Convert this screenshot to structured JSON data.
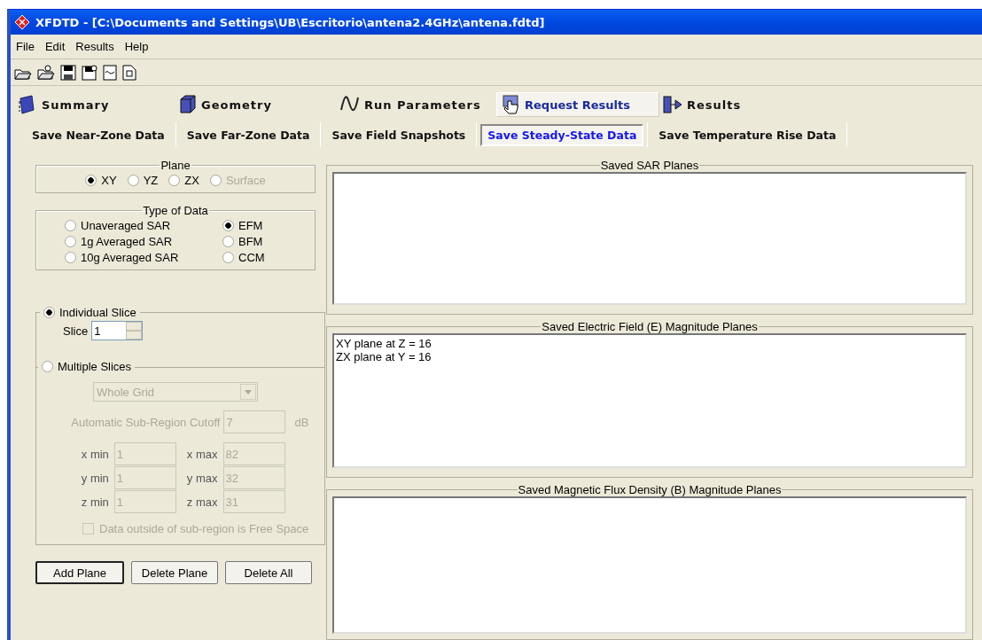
{
  "window": {
    "title": "XFDTD - [C:\\Documents and Settings\\UB\\Escritorio\\antena2.4GHz\\antena.fdtd]"
  },
  "menu": [
    "File",
    "Edit",
    "Results",
    "Help"
  ],
  "main_tabs": [
    {
      "label": "Summary",
      "selected": false
    },
    {
      "label": "Geometry",
      "selected": false
    },
    {
      "label": "Run Parameters",
      "selected": false
    },
    {
      "label": "Request Results",
      "selected": true
    },
    {
      "label": "Results",
      "selected": false
    }
  ],
  "sub_tabs": [
    {
      "label": "Save Near-Zone Data",
      "selected": false
    },
    {
      "label": "Save Far-Zone Data",
      "selected": false
    },
    {
      "label": "Save Field Snapshots",
      "selected": false
    },
    {
      "label": "Save Steady-State Data",
      "selected": true
    },
    {
      "label": "Save Temperature Rise Data",
      "selected": false
    }
  ],
  "plane": {
    "title": "Plane",
    "options": [
      {
        "label": "XY",
        "selected": true,
        "disabled": false
      },
      {
        "label": "YZ",
        "selected": false,
        "disabled": false
      },
      {
        "label": "ZX",
        "selected": false,
        "disabled": false
      },
      {
        "label": "Surface",
        "selected": false,
        "disabled": true
      }
    ]
  },
  "type_of_data": {
    "title": "Type of Data",
    "options": [
      {
        "label": "Unaveraged SAR",
        "selected": false
      },
      {
        "label": "EFM",
        "selected": true
      },
      {
        "label": "1g Averaged SAR",
        "selected": false
      },
      {
        "label": "BFM",
        "selected": false
      },
      {
        "label": "10g Averaged SAR",
        "selected": false
      },
      {
        "label": "CCM",
        "selected": false
      }
    ]
  },
  "individual_slice": {
    "label": "Individual Slice",
    "selected": true,
    "slice_label": "Slice",
    "slice_value": "1"
  },
  "multiple_slices": {
    "label": "Multiple Slices",
    "selected": false,
    "disabled": true,
    "region": "Whole Grid",
    "cutoff_label": "Automatic Sub-Region Cutoff",
    "cutoff_value": "7",
    "cutoff_unit": "dB",
    "ranges": [
      {
        "label": "x min",
        "value": "1"
      },
      {
        "label": "x max",
        "value": "82"
      },
      {
        "label": "y min",
        "value": "1"
      },
      {
        "label": "y max",
        "value": "32"
      },
      {
        "label": "z min",
        "value": "1"
      },
      {
        "label": "z max",
        "value": "31"
      }
    ],
    "free_space": {
      "label": "Data outside of sub-region is Free Space",
      "checked": false
    }
  },
  "buttons": [
    {
      "label": "Add Plane",
      "default": true
    },
    {
      "label": "Delete Plane",
      "default": false
    },
    {
      "label": "Delete All",
      "default": false
    }
  ],
  "lists": [
    {
      "title": "Saved SAR Planes"
    },
    {
      "title": "Saved Electric Field (E) Magnitude Planes",
      "items": [
        "XY plane at Z = 16",
        "ZX plane at Y = 16"
      ]
    },
    {
      "title": "Saved Magnetic Flux Density (B) Magnitude Planes"
    }
  ]
}
